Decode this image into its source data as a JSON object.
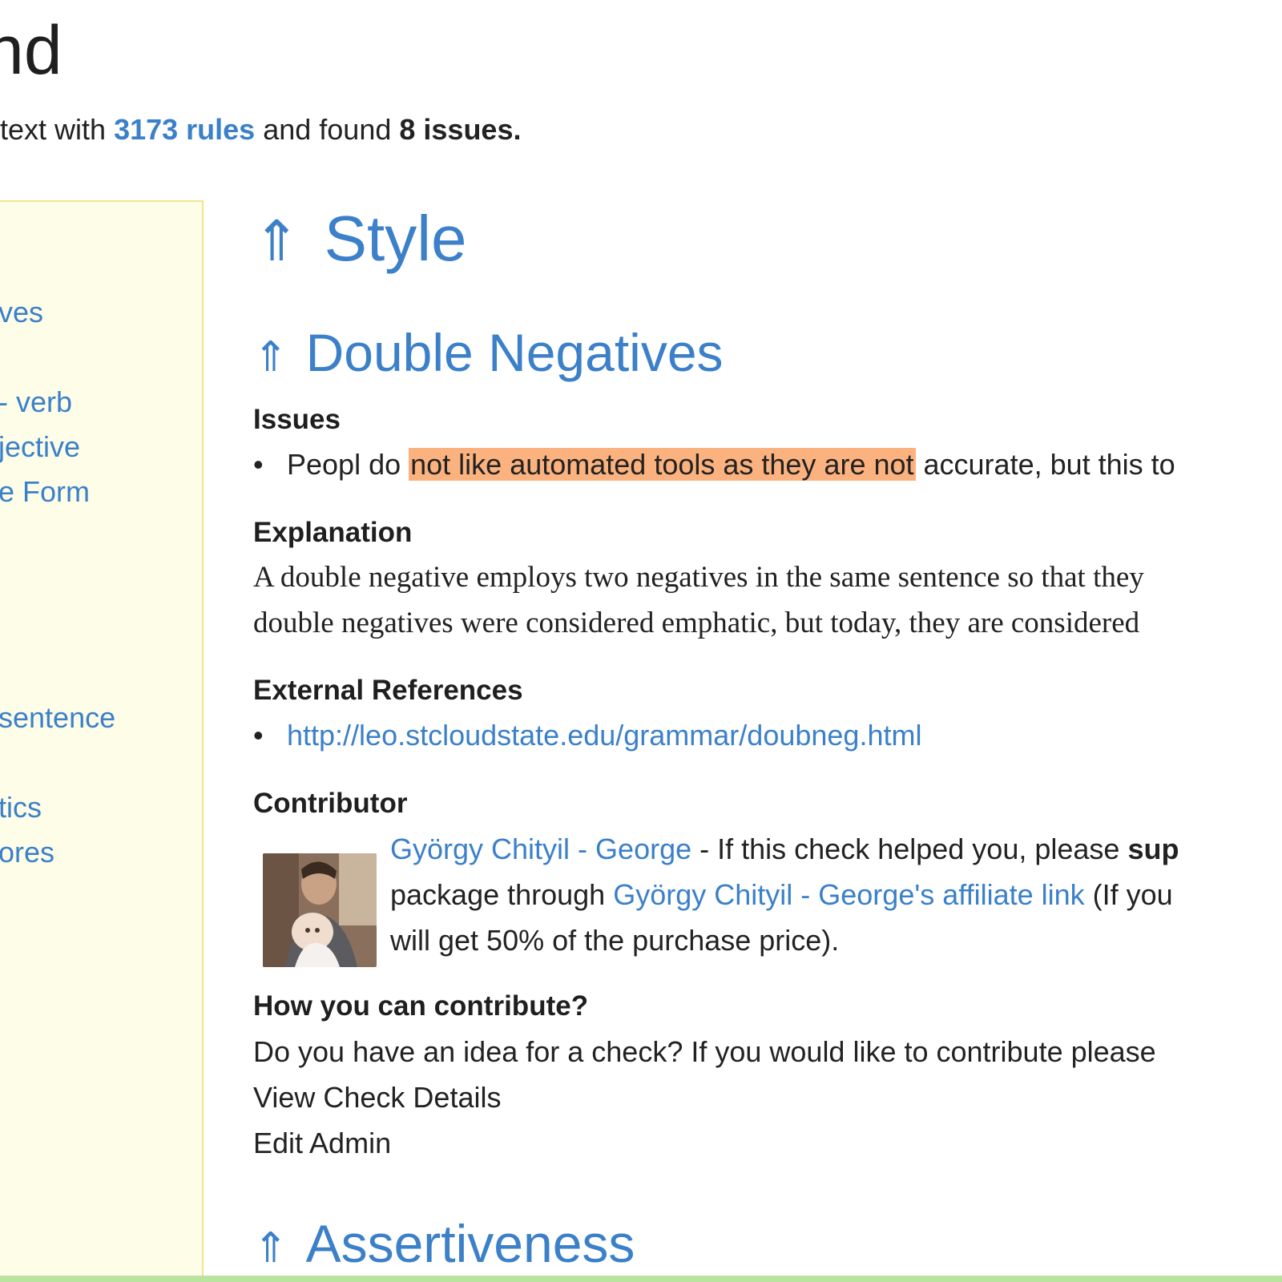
{
  "header": {
    "title": "nd",
    "summary_prefix": "text with ",
    "rules_link": "3173 rules",
    "summary_mid": " and found ",
    "issues_count": "8 issues."
  },
  "sidebar": {
    "items": [
      "ves",
      "- verb",
      "jective",
      "e Form",
      "sentence",
      "tics",
      "ores"
    ]
  },
  "main": {
    "arrow": "⇑",
    "section_title": "Style",
    "check_title": "Double Negatives",
    "issues_heading": "Issues",
    "issue": {
      "before": "Peopl do ",
      "highlight": "not like automated tools as they are not",
      "after": " accurate, but this to"
    },
    "explanation_heading": "Explanation",
    "explanation_lines": [
      "A double negative employs two negatives in the same sentence so that they",
      "double negatives were considered emphatic, but today, they are considered"
    ],
    "references_heading": "External References",
    "reference_link": "http://leo.stcloudstate.edu/grammar/doubneg.html",
    "contributor_heading": "Contributor",
    "contributor": {
      "name_link": "György Chityil - George",
      "line1_text": " - If this check helped you, please ",
      "line1_bold": "sup",
      "line2_prefix": "package through ",
      "affiliate_link": "György Chityil - George's affiliate link",
      "line2_suffix": " (If you",
      "line3": "will get 50% of the purchase price)."
    },
    "contribute_heading": "How you can contribute?",
    "contribute_text": "Do you have an idea for a check? If you would like to contribute please",
    "view_details_link": "View Check Details",
    "edit_admin_link": "Edit Admin",
    "next_section_title": "Assertiveness"
  }
}
